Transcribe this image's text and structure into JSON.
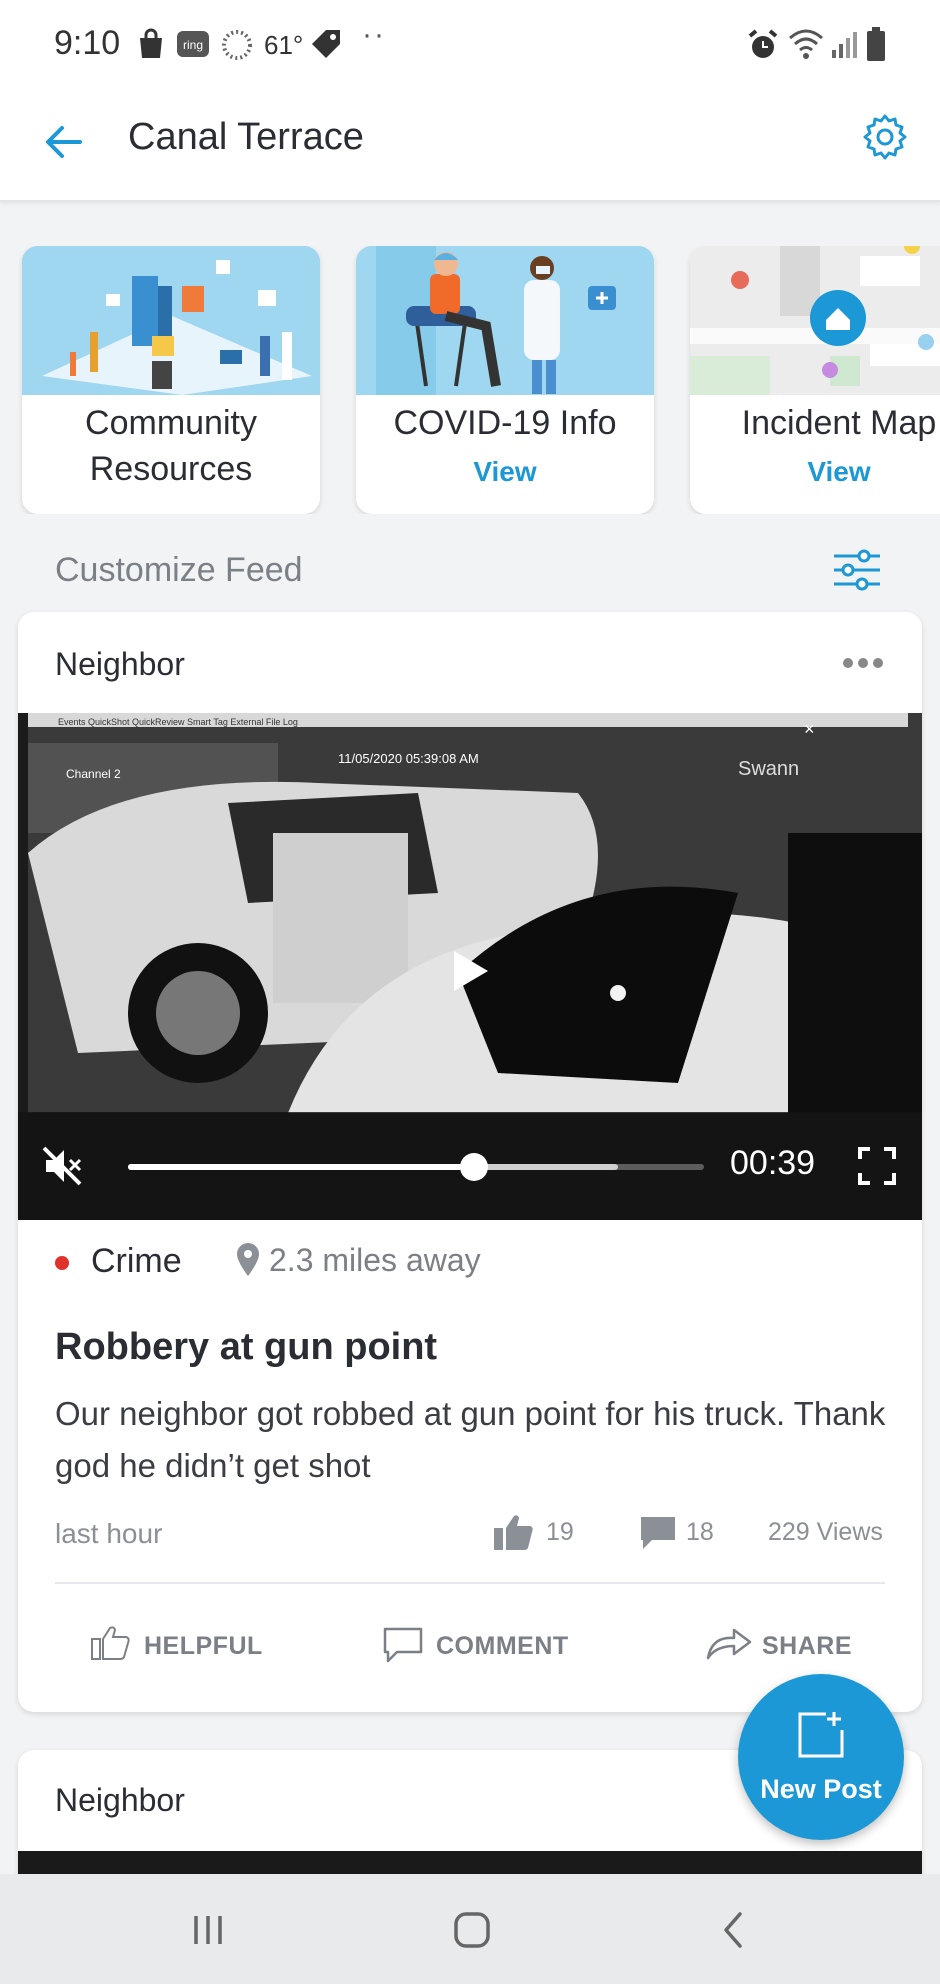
{
  "status_bar": {
    "time": "9:10",
    "temperature": "61°",
    "overflow": "··"
  },
  "header": {
    "title": "Canal Terrace"
  },
  "resource_cards": [
    {
      "title_line1": "Community",
      "title_line2": "Resources",
      "action": ""
    },
    {
      "title_line1": "COVID-19 Info",
      "title_line2": "",
      "action": "View"
    },
    {
      "title_line1": "Incident Map",
      "title_line2": "",
      "action": "View"
    }
  ],
  "feed": {
    "customize_label": "Customize Feed"
  },
  "post": {
    "author": "Neighbor",
    "video": {
      "elapsed": "00:39",
      "progress": 0.6,
      "buffered": 0.85,
      "muted": true,
      "overlay_timestamp": "11/05/2020  05:39:08  AM",
      "overlay_channel": "Channel 2",
      "overlay_brand": "Swann"
    },
    "category": "Crime",
    "category_color": "#e0312a",
    "distance": "2.3 miles away",
    "title": "Robbery at gun point",
    "body": "Our neighbor got robbed at gun point for his truck. Thank god he didn’t get shot",
    "time_ago": "last hour",
    "likes": "19",
    "comments": "18",
    "views": "229 Views",
    "actions": {
      "helpful": "HELPFUL",
      "comment": "COMMENT",
      "share": "SHARE"
    }
  },
  "post2": {
    "author": "Neighbor"
  },
  "fab": {
    "label": "New Post"
  },
  "colors": {
    "accent": "#1c98d6",
    "crime": "#e0312a"
  }
}
